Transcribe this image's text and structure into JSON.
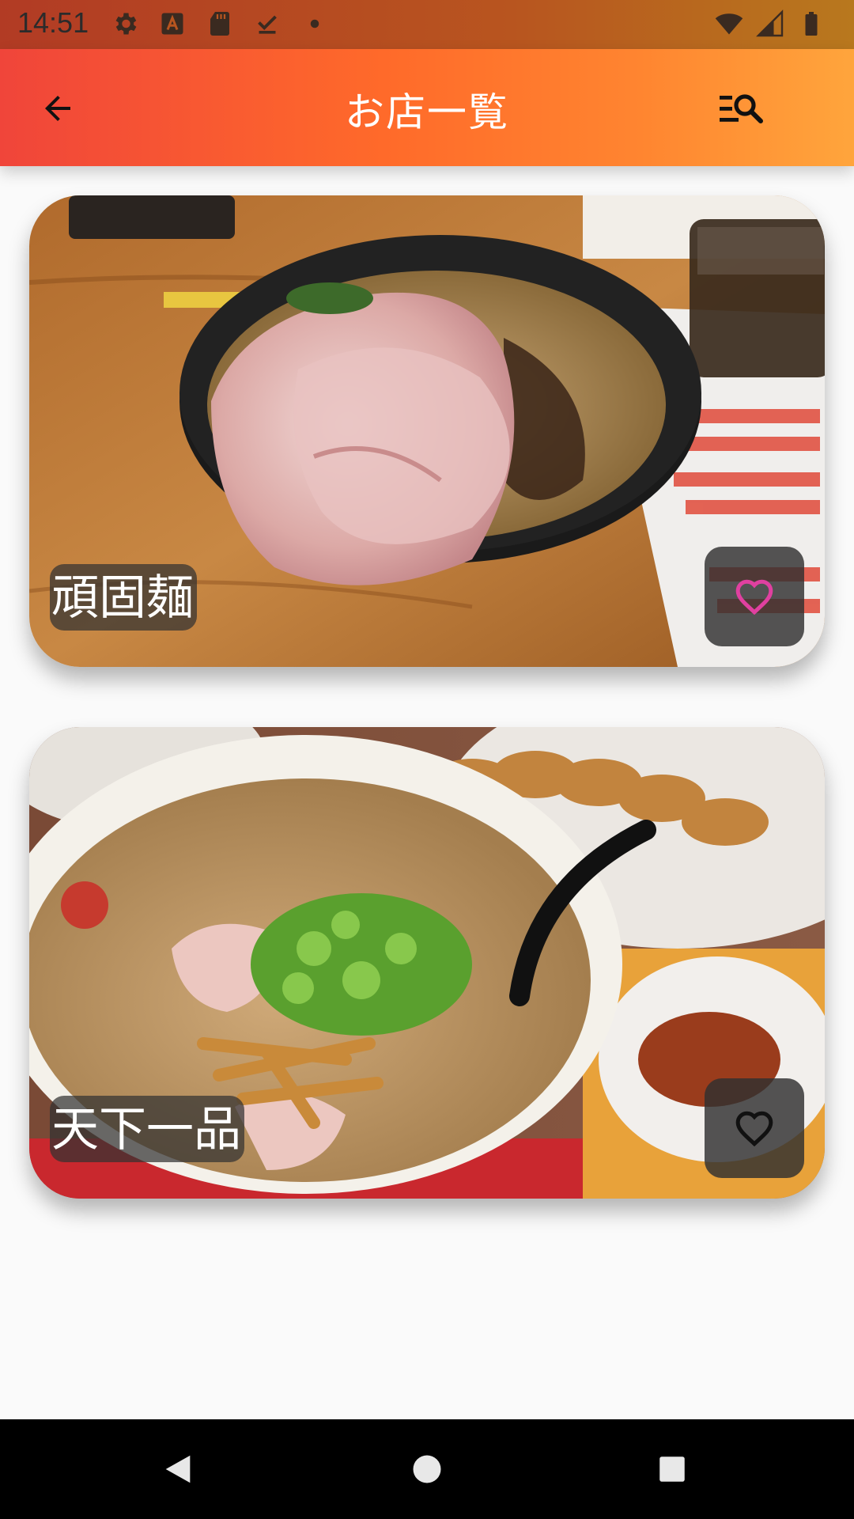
{
  "status_bar": {
    "time": "14:51",
    "left_icons": [
      "gear-icon",
      "keyboard-a-icon",
      "sd-card-icon",
      "download-done-icon",
      "dot-icon"
    ],
    "right_icons": [
      "wifi-icon",
      "signal-icon",
      "battery-icon"
    ]
  },
  "app_bar": {
    "title": "お店一覧",
    "back_icon": "arrow-back-icon",
    "search_icon": "list-search-icon",
    "gradient_start": "#f0453a",
    "gradient_end": "#ffa53c"
  },
  "shops": [
    {
      "name": "頑固麺",
      "favorite": true,
      "heart_color": "#e040a0"
    },
    {
      "name": "天下一品",
      "favorite": false,
      "heart_color": "#111111"
    }
  ],
  "nav_bar": {
    "icons": [
      "nav-back-icon",
      "nav-home-icon",
      "nav-recents-icon"
    ]
  }
}
